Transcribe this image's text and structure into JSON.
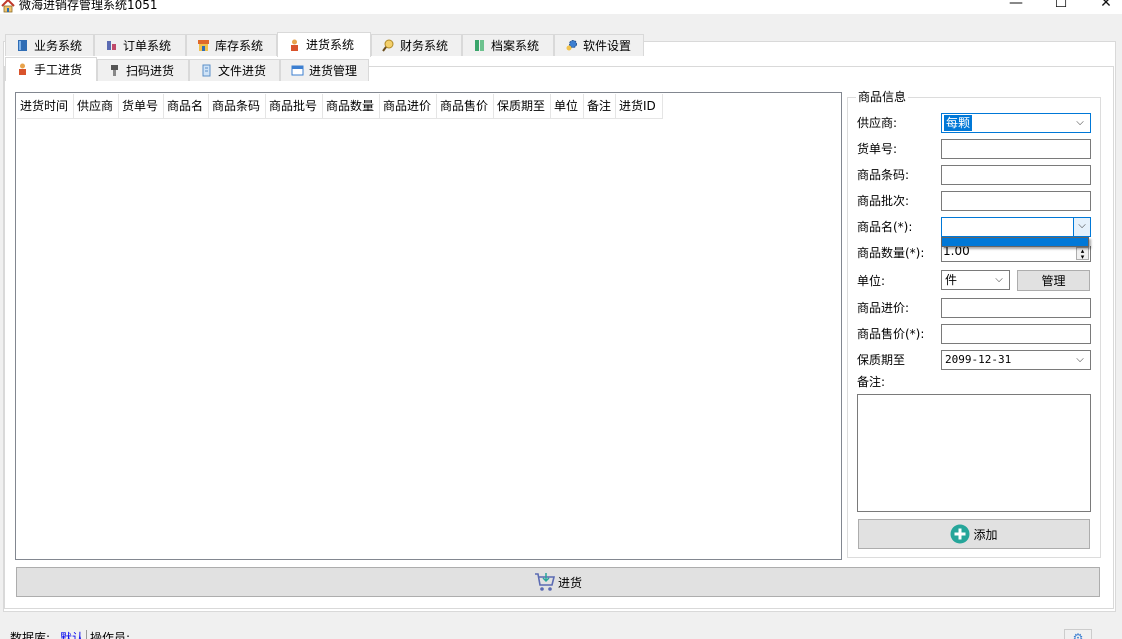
{
  "window": {
    "title": "微海进销存管理系统1051",
    "min": "—",
    "max": "☐",
    "close": "✕"
  },
  "main_tabs": [
    {
      "label": "业务系统",
      "icon": "book-icon"
    },
    {
      "label": "订单系统",
      "icon": "order-icon"
    },
    {
      "label": "库存系统",
      "icon": "warehouse-icon"
    },
    {
      "label": "进货系统",
      "icon": "person-icon",
      "active": true
    },
    {
      "label": "财务系统",
      "icon": "magnifier-icon"
    },
    {
      "label": "档案系统",
      "icon": "archive-icon"
    },
    {
      "label": "软件设置",
      "icon": "gear-icon"
    }
  ],
  "sub_tabs": [
    {
      "label": "手工进货",
      "icon": "person-icon",
      "active": true
    },
    {
      "label": "扫码进货",
      "icon": "scanner-icon"
    },
    {
      "label": "文件进货",
      "icon": "file-icon"
    },
    {
      "label": "进货管理",
      "icon": "window-icon"
    }
  ],
  "table": {
    "columns": [
      "进货时间",
      "供应商",
      "货单号",
      "商品名",
      "商品条码",
      "商品批号",
      "商品数量",
      "商品进价",
      "商品售价",
      "保质期至",
      "单位",
      "备注",
      "进货ID"
    ],
    "rows": []
  },
  "form": {
    "group_title": "商品信息",
    "supplier": {
      "label": "供应商:",
      "value": "每颗"
    },
    "order_no": {
      "label": "货单号:",
      "value": ""
    },
    "barcode": {
      "label": "商品条码:",
      "value": ""
    },
    "batch": {
      "label": "商品批次:",
      "value": ""
    },
    "product_name": {
      "label": "商品名(*):",
      "value": ""
    },
    "quantity": {
      "label": "商品数量(*):",
      "value": "1.00"
    },
    "unit": {
      "label": "单位:",
      "value": "件",
      "manage_button": "管理"
    },
    "cost_price": {
      "label": "商品进价:",
      "value": ""
    },
    "sale_price": {
      "label": "商品售价(*):",
      "value": ""
    },
    "expiry": {
      "label": "保质期至",
      "value": "2099-12-31"
    },
    "remark": {
      "label": "备注:",
      "value": ""
    },
    "add_button": "添加"
  },
  "purchase_button": "进货",
  "status": {
    "db_label": "数据库:",
    "db_value": "默认",
    "operator_label": "操作员:"
  },
  "colors": {
    "accent": "#0078d7",
    "add_icon": "#26a69a",
    "cart_icon": "#5b6bb3"
  }
}
